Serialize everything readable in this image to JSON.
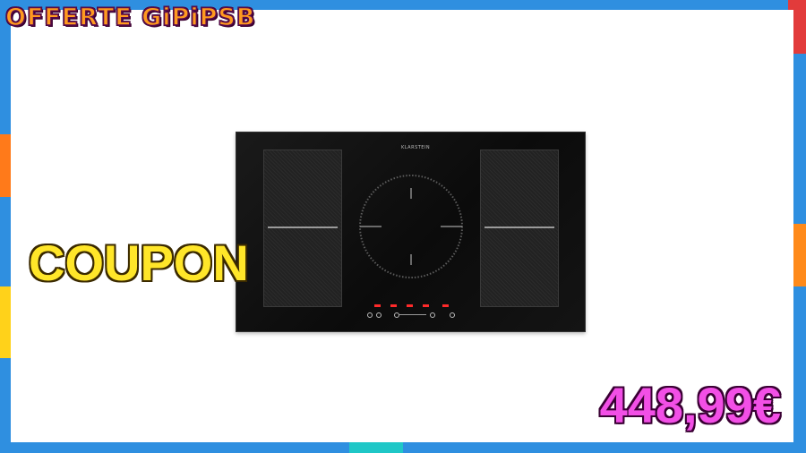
{
  "banner": {
    "text": "OFFERTE GiPiPSB"
  },
  "coupon": {
    "text": "COUPON"
  },
  "price": {
    "text": "448,99€"
  },
  "product": {
    "brand_label": "KLARSTEIN"
  },
  "colors": {
    "background": "#2f8fe0",
    "banner_text": "#ff9a1f",
    "coupon_text": "#ffe629",
    "price_text": "#f24fe6",
    "hob": "#111111"
  }
}
